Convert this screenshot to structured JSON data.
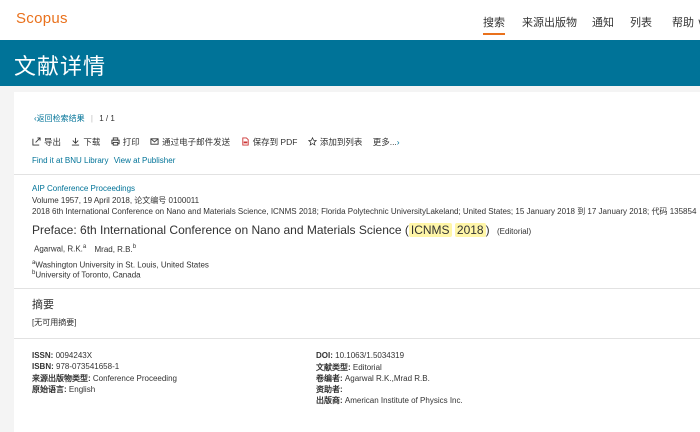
{
  "header": {
    "logo": "Scopus",
    "nav": [
      "搜索",
      "来源出版物",
      "通知",
      "列表",
      "帮助 ∨"
    ]
  },
  "banner": {
    "title": "文献详情"
  },
  "results_nav": {
    "back": "返回检索结果",
    "page": "1 / 1"
  },
  "toolbar": {
    "export": "导出",
    "download": "下载",
    "print": "打印",
    "email": "通过电子邮件发送",
    "save_pdf": "保存到 PDF",
    "add_list": "添加到列表",
    "more": "更多..."
  },
  "library_links": {
    "bnu": "Find it at BNU Library",
    "publisher": "View at Publisher"
  },
  "source": {
    "name": "AIP Conference Proceedings",
    "volume": "Volume 1957, 19 April 2018, 论文编号 0100011",
    "conference": "2018 6th International Conference on Nano and Materials Science, ICNMS 2018; Florida Polytechnic UniversityLakeland; United States; 15 January 2018 到 17 January 2018; 代码 135854"
  },
  "article": {
    "title_prefix": "Preface: 6th International Conference on Nano and Materials Science (",
    "title_hl1": "ICNMS",
    "title_hl2": "2018",
    "title_suffix": ")",
    "doc_type": "(Editorial)",
    "author1": "Agarwal, R.K.",
    "author1_sup": "a",
    "author2": "Mrad, R.B.",
    "author2_sup": "b",
    "affil_a_sup": "a",
    "affil_a": "Washington University in St. Louis, United States",
    "affil_b_sup": "b",
    "affil_b": "University of Toronto, Canada"
  },
  "abstract": {
    "heading": "摘要",
    "text": "[无可用摘要]"
  },
  "details": {
    "issn_label": "ISSN:",
    "issn": "0094243X",
    "isbn_label": "ISBN:",
    "isbn": "978-073541658-1",
    "srctype_label": "来源出版物类型:",
    "srctype": "Conference Proceeding",
    "lang_label": "原始语言:",
    "lang": "English",
    "doi_label": "DOI:",
    "doi": "10.1063/1.5034319",
    "doctype_label": "文献类型:",
    "doctype": "Editorial",
    "editors_label": "卷编者:",
    "editors": "Agarwal R.K.,Mrad R.B.",
    "sponsors_label": "资助者:",
    "publisher_label": "出版商:",
    "publisher": "American Institute of Physics Inc."
  }
}
